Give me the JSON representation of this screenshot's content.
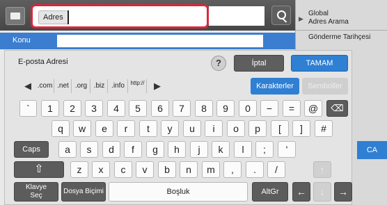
{
  "address": {
    "tag_label": "Adres"
  },
  "right_panel": {
    "global_search": "Global Adres Arama",
    "global_line1": "Global",
    "global_line2": "Adres Arama",
    "history": "Gönderme Tarihçesi",
    "ca": "CA"
  },
  "subject": {
    "label": "Konu"
  },
  "keyboard": {
    "mode_label": "E-posta Adresi",
    "help": "?",
    "cancel": "İptal",
    "ok": "TAMAM",
    "suffixes": [
      ".com",
      ".net",
      ".org",
      ".biz",
      ".info",
      "http://"
    ],
    "tabs": {
      "characters": "Karakterler",
      "symbols": "Semboller"
    },
    "row1": [
      "`",
      "1",
      "2",
      "3",
      "4",
      "5",
      "6",
      "7",
      "8",
      "9",
      "0",
      "−",
      "=",
      "@"
    ],
    "row2": [
      "q",
      "w",
      "e",
      "r",
      "t",
      "y",
      "u",
      "i",
      "o",
      "p",
      "[",
      "]",
      "#"
    ],
    "row3_caps": "Caps",
    "row3": [
      "a",
      "s",
      "d",
      "f",
      "g",
      "h",
      "j",
      "k",
      "l",
      ";",
      "'"
    ],
    "row4": [
      "z",
      "x",
      "c",
      "v",
      "b",
      "n",
      "m",
      ",",
      ".",
      "/"
    ],
    "shift_glyph": "⇧",
    "up_arrow": "↑",
    "keyboard_select_line1": "Klavye",
    "keyboard_select_line2": "Seç",
    "file_format": "Dosya Biçimi",
    "space": "Boşluk",
    "altgr": "AltGr",
    "left_arrow": "←",
    "down_arrow": "↓",
    "right_arrow": "→",
    "backspace_glyph": "⌫"
  },
  "colors": {
    "accent": "#2f7fd3",
    "highlight": "#d9273b",
    "dark_key": "#5c5c5c"
  }
}
